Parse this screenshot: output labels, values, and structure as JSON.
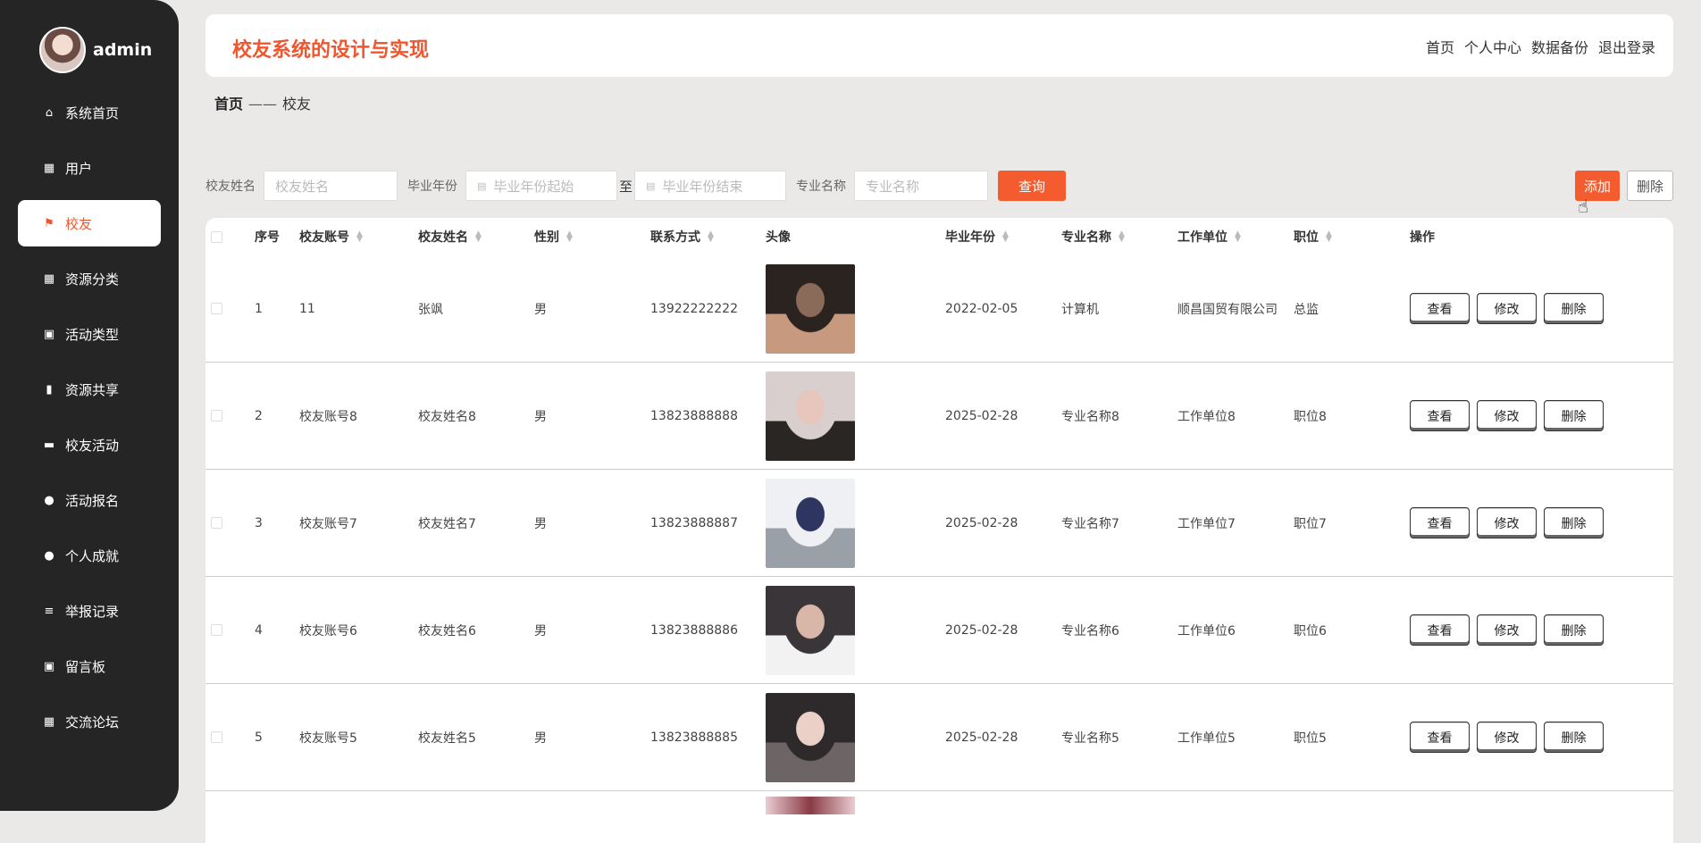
{
  "sidebar": {
    "username": "admin",
    "items": [
      {
        "label": "系统首页",
        "icon": "home-icon",
        "glyph": "⌂",
        "active": false
      },
      {
        "label": "用户",
        "icon": "grid-icon",
        "glyph": "▦",
        "active": false
      },
      {
        "label": "校友",
        "icon": "flag-icon",
        "glyph": "⚑",
        "active": true
      },
      {
        "label": "资源分类",
        "icon": "grid-icon",
        "glyph": "▦",
        "active": false
      },
      {
        "label": "活动类型",
        "icon": "clipboard-icon",
        "glyph": "▣",
        "active": false
      },
      {
        "label": "资源共享",
        "icon": "book-icon",
        "glyph": "▮",
        "active": false
      },
      {
        "label": "校友活动",
        "icon": "briefcase-icon",
        "glyph": "▬",
        "active": false
      },
      {
        "label": "活动报名",
        "icon": "person-icon",
        "glyph": "●",
        "active": false
      },
      {
        "label": "个人成就",
        "icon": "bulb-icon",
        "glyph": "●",
        "active": false
      },
      {
        "label": "举报记录",
        "icon": "sliders-icon",
        "glyph": "≡",
        "active": false
      },
      {
        "label": "留言板",
        "icon": "clipboard-icon",
        "glyph": "▣",
        "active": false
      },
      {
        "label": "交流论坛",
        "icon": "grid-icon",
        "glyph": "▦",
        "active": false
      }
    ]
  },
  "header": {
    "title": "校友系统的设计与实现",
    "links": [
      "首页",
      "个人中心",
      "数据备份",
      "退出登录"
    ]
  },
  "breadcrumb": {
    "home": "首页",
    "sep": "——",
    "current": "校友"
  },
  "search": {
    "name_label": "校友姓名",
    "name_placeholder": "校友姓名",
    "year_label": "毕业年份",
    "year_start_placeholder": "毕业年份起始",
    "to": "至",
    "year_end_placeholder": "毕业年份结束",
    "major_label": "专业名称",
    "major_placeholder": "专业名称",
    "query_button": "查询",
    "add_button": "添加",
    "delete_button": "删除"
  },
  "table": {
    "columns": [
      "序号",
      "校友账号",
      "校友姓名",
      "性别",
      "联系方式",
      "头像",
      "毕业年份",
      "专业名称",
      "工作单位",
      "职位",
      "操作"
    ],
    "actions": [
      "查看",
      "修改",
      "删除"
    ],
    "rows": [
      {
        "no": "1",
        "account": "11",
        "name": "张飒",
        "gender": "男",
        "phone": "13922222222",
        "year": "2022-02-05",
        "major": "计算机",
        "company": "顺昌国贸有限公司",
        "position": "总监",
        "photo": [
          "#2b2320",
          "#8a6a58",
          "#c79a80"
        ]
      },
      {
        "no": "2",
        "account": "校友账号8",
        "name": "校友姓名8",
        "gender": "男",
        "phone": "13823888888",
        "year": "2025-02-28",
        "major": "专业名称8",
        "company": "工作单位8",
        "position": "职位8",
        "photo": [
          "#d9cfcf",
          "#e7c6bb",
          "#2a2624"
        ]
      },
      {
        "no": "3",
        "account": "校友账号7",
        "name": "校友姓名7",
        "gender": "男",
        "phone": "13823888887",
        "year": "2025-02-28",
        "major": "专业名称7",
        "company": "工作单位7",
        "position": "职位7",
        "photo": [
          "#eef0f4",
          "#2d3560",
          "#9aa0a8"
        ]
      },
      {
        "no": "4",
        "account": "校友账号6",
        "name": "校友姓名6",
        "gender": "男",
        "phone": "13823888886",
        "year": "2025-02-28",
        "major": "专业名称6",
        "company": "工作单位6",
        "position": "职位6",
        "photo": [
          "#3a3538",
          "#d8b7a8",
          "#f2f2f2"
        ]
      },
      {
        "no": "5",
        "account": "校友账号5",
        "name": "校友姓名5",
        "gender": "男",
        "phone": "13823888885",
        "year": "2025-02-28",
        "major": "专业名称5",
        "company": "工作单位5",
        "position": "职位5",
        "photo": [
          "#2e2a2c",
          "#ead0c6",
          "#6d6466"
        ]
      }
    ]
  }
}
